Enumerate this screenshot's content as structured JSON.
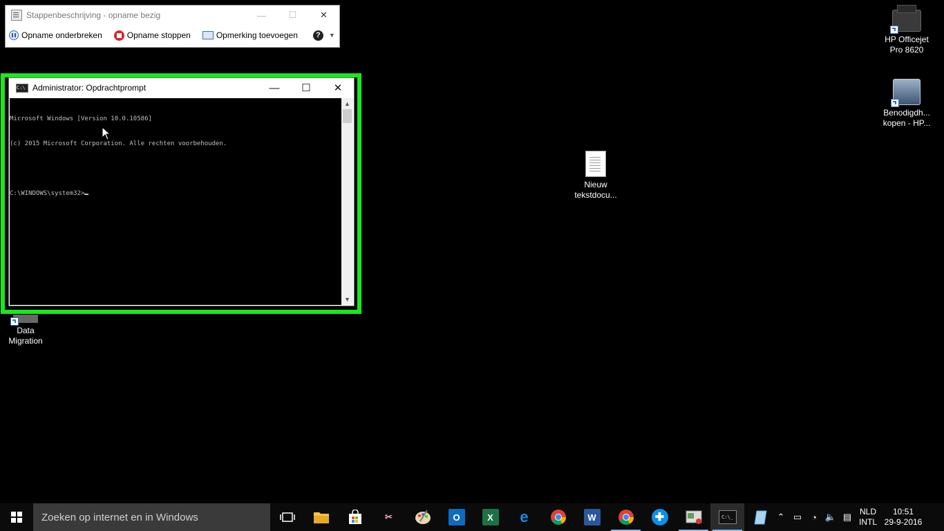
{
  "steps_recorder": {
    "title": "Stappenbeschrijving - opname bezig",
    "pause_label": "Opname onderbreken",
    "stop_label": "Opname stoppen",
    "comment_label": "Opmerking toevoegen",
    "help_glyph": "?",
    "dropdown_glyph": "▼"
  },
  "cmd_window": {
    "title": "Administrator: Opdrachtprompt",
    "lines": [
      "Microsoft Windows [Version 10.0.10586]",
      "(c) 2015 Microsoft Corporation. Alle rechten voorbehouden.",
      "",
      "C:\\WINDOWS\\system32>"
    ],
    "icon_glyph": "C:\\"
  },
  "desktop_icons": [
    {
      "line1": "HP Officejet",
      "line2": "Pro 8620"
    },
    {
      "line1": "Benodigdh...",
      "line2": "kopen - HP..."
    },
    {
      "line1": "Nieuw",
      "line2": "tekstdocu..."
    },
    {
      "line1": "Data",
      "line2": "Migration"
    }
  ],
  "taskbar": {
    "search_placeholder": "Zoeken op internet en in Windows",
    "apps": [
      {
        "name": "task-view",
        "glyph": "▭",
        "color": "#0b0b0b"
      },
      {
        "name": "file-explorer",
        "glyph": "",
        "color": "#e8b33a"
      },
      {
        "name": "store",
        "glyph": "",
        "color": "#ffffff"
      },
      {
        "name": "snipping",
        "glyph": "✂",
        "color": "#0b0b0b"
      },
      {
        "name": "paint",
        "glyph": "🎨",
        "color": "#0b0b0b"
      },
      {
        "name": "outlook",
        "glyph": "O",
        "color": "#0f6cbd"
      },
      {
        "name": "excel",
        "glyph": "X",
        "color": "#1e7145"
      },
      {
        "name": "edge",
        "glyph": "e",
        "color": "#0b0b0b"
      },
      {
        "name": "chrome",
        "glyph": "",
        "color": "#0b0b0b"
      },
      {
        "name": "word",
        "glyph": "W",
        "color": "#2b579a"
      },
      {
        "name": "chrome-2",
        "glyph": "",
        "color": "#0b0b0b"
      },
      {
        "name": "teamviewer",
        "glyph": "✚",
        "color": "#0e8ee9"
      },
      {
        "name": "steps-recorder",
        "glyph": "",
        "color": "#0b0b0b"
      },
      {
        "name": "cmd",
        "glyph": "C:\\_",
        "color": "#0b0b0b"
      },
      {
        "name": "notepad",
        "glyph": "",
        "color": "#0b0b0b"
      }
    ],
    "language_1": "NLD",
    "language_2": "INTL",
    "time": "10:51",
    "date": "29-9-2016"
  }
}
